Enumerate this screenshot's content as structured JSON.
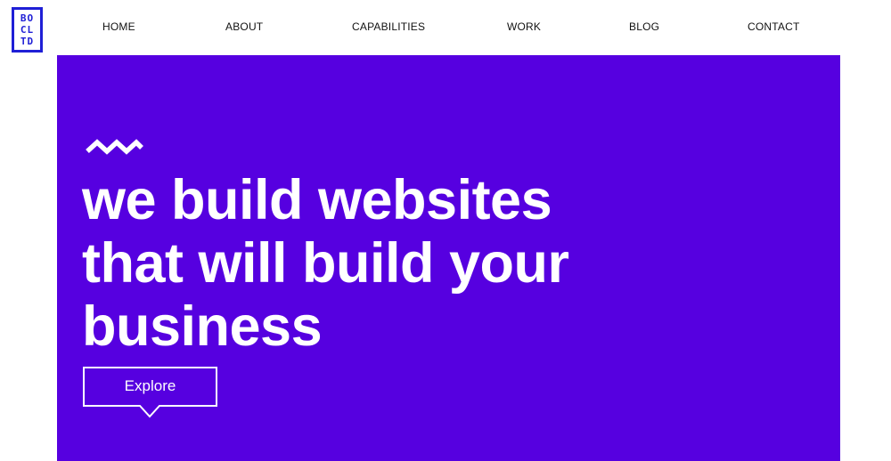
{
  "logo": {
    "lines": [
      "BO",
      "CL",
      "TD"
    ],
    "color": "#1f1fd6"
  },
  "nav": {
    "items": [
      {
        "label": "HOME"
      },
      {
        "label": "ABOUT"
      },
      {
        "label": "CAPABILITIES"
      },
      {
        "label": "WORK"
      },
      {
        "label": "BLOG"
      },
      {
        "label": "CONTACT"
      }
    ]
  },
  "hero": {
    "background": "#5600e0",
    "decoration_icon": "zigzag-wave-icon",
    "headline_lines": [
      "we build websites",
      "that will build your",
      "business"
    ],
    "cta_label": "Explore"
  }
}
